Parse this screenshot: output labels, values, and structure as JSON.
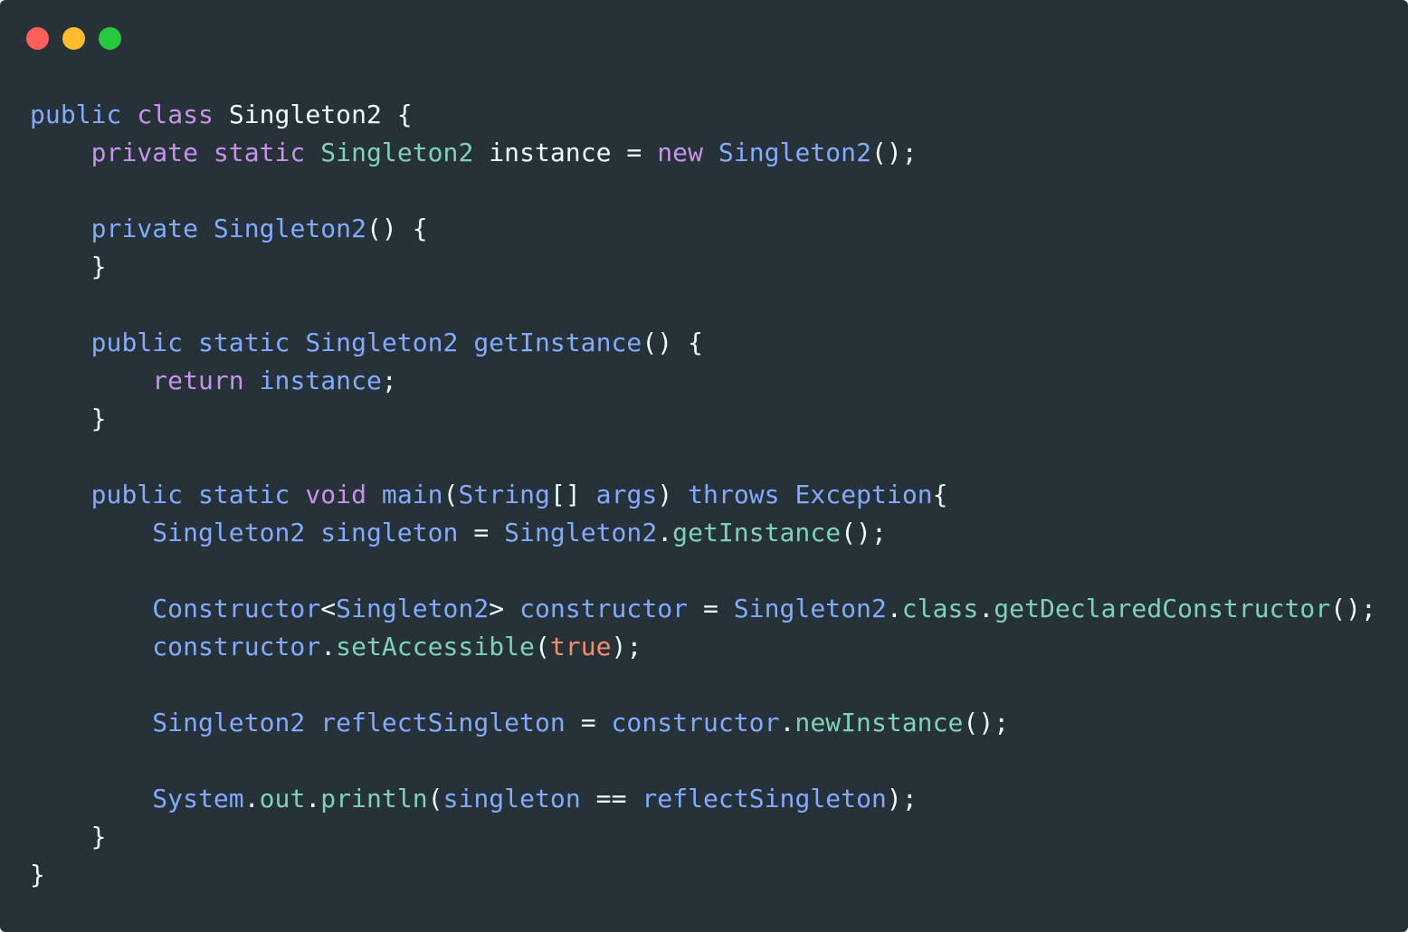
{
  "window": {
    "controls": [
      {
        "name": "close-button",
        "color": "#ff5f56"
      },
      {
        "name": "minimize-button",
        "color": "#ffbd2e"
      },
      {
        "name": "maximize-button",
        "color": "#27c93f"
      }
    ],
    "background": "#263238"
  },
  "colors": {
    "plain": "#eeffff",
    "kw": "#c792ea",
    "blue": "#82aaff",
    "green": "#7fd3b5",
    "orange": "#f78c6c"
  },
  "code": {
    "language": "java",
    "lines": [
      [
        {
          "t": "public",
          "c": "blue"
        },
        {
          "t": " "
        },
        {
          "t": "class",
          "c": "kw"
        },
        {
          "t": " Singleton2 {"
        }
      ],
      [
        {
          "t": "    "
        },
        {
          "t": "private static",
          "c": "kw"
        },
        {
          "t": " "
        },
        {
          "t": "Singleton2",
          "c": "green"
        },
        {
          "t": " instance = "
        },
        {
          "t": "new",
          "c": "kw"
        },
        {
          "t": " "
        },
        {
          "t": "Singleton2",
          "c": "blue"
        },
        {
          "t": "();"
        }
      ],
      [],
      [
        {
          "t": "    "
        },
        {
          "t": "private",
          "c": "blue"
        },
        {
          "t": " "
        },
        {
          "t": "Singleton2",
          "c": "blue"
        },
        {
          "t": "() {"
        }
      ],
      [
        {
          "t": "    }"
        }
      ],
      [],
      [
        {
          "t": "    "
        },
        {
          "t": "public static Singleton2 getInstance",
          "c": "blue"
        },
        {
          "t": "() {"
        }
      ],
      [
        {
          "t": "        "
        },
        {
          "t": "return",
          "c": "kw"
        },
        {
          "t": " "
        },
        {
          "t": "instance",
          "c": "blue"
        },
        {
          "t": ";"
        }
      ],
      [
        {
          "t": "    }"
        }
      ],
      [],
      [
        {
          "t": "    "
        },
        {
          "t": "public static",
          "c": "blue"
        },
        {
          "t": " "
        },
        {
          "t": "void",
          "c": "kw"
        },
        {
          "t": " "
        },
        {
          "t": "main",
          "c": "blue"
        },
        {
          "t": "("
        },
        {
          "t": "String",
          "c": "blue"
        },
        {
          "t": "[] "
        },
        {
          "t": "args",
          "c": "blue"
        },
        {
          "t": ") "
        },
        {
          "t": "throws Exception",
          "c": "blue"
        },
        {
          "t": "{"
        }
      ],
      [
        {
          "t": "        "
        },
        {
          "t": "Singleton2 singleton",
          "c": "blue"
        },
        {
          "t": " = "
        },
        {
          "t": "Singleton2",
          "c": "blue"
        },
        {
          "t": "."
        },
        {
          "t": "getInstance",
          "c": "green"
        },
        {
          "t": "();"
        }
      ],
      [],
      [
        {
          "t": "        "
        },
        {
          "t": "Constructor",
          "c": "blue"
        },
        {
          "t": "<"
        },
        {
          "t": "Singleton2",
          "c": "blue"
        },
        {
          "t": "> "
        },
        {
          "t": "constructor",
          "c": "blue"
        },
        {
          "t": " = "
        },
        {
          "t": "Singleton2",
          "c": "blue"
        },
        {
          "t": "."
        },
        {
          "t": "class",
          "c": "green"
        },
        {
          "t": "."
        },
        {
          "t": "getDeclaredConstructor",
          "c": "green"
        },
        {
          "t": "();"
        }
      ],
      [
        {
          "t": "        "
        },
        {
          "t": "constructor",
          "c": "blue"
        },
        {
          "t": "."
        },
        {
          "t": "setAccessible",
          "c": "green"
        },
        {
          "t": "("
        },
        {
          "t": "true",
          "c": "orange"
        },
        {
          "t": ");"
        }
      ],
      [],
      [
        {
          "t": "        "
        },
        {
          "t": "Singleton2 reflectSingleton",
          "c": "blue"
        },
        {
          "t": " = "
        },
        {
          "t": "constructor",
          "c": "blue"
        },
        {
          "t": "."
        },
        {
          "t": "newInstance",
          "c": "green"
        },
        {
          "t": "();"
        }
      ],
      [],
      [
        {
          "t": "        "
        },
        {
          "t": "System",
          "c": "blue"
        },
        {
          "t": "."
        },
        {
          "t": "out",
          "c": "green"
        },
        {
          "t": "."
        },
        {
          "t": "println",
          "c": "green"
        },
        {
          "t": "("
        },
        {
          "t": "singleton",
          "c": "blue"
        },
        {
          "t": " == "
        },
        {
          "t": "reflectSingleton",
          "c": "blue"
        },
        {
          "t": ");"
        }
      ],
      [
        {
          "t": "    }"
        }
      ],
      [
        {
          "t": "}"
        }
      ]
    ]
  }
}
